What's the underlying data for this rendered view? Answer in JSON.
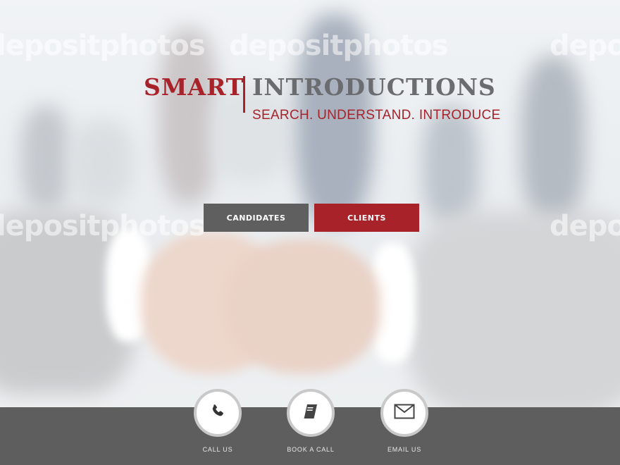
{
  "hero": {
    "watermark_text": "depositphotos"
  },
  "logo": {
    "word_primary": "SMART",
    "word_secondary": "INTRODUCTIONS",
    "tagline": "SEARCH. UNDERSTAND. INTRODUCE"
  },
  "buttons": {
    "candidates_label": "CANDIDATES",
    "clients_label": "CLIENTS"
  },
  "contact_actions": [
    {
      "label": "CALL US",
      "icon": "phone-icon"
    },
    {
      "label": "BOOK A CALL",
      "icon": "book-icon"
    },
    {
      "label": "EMAIL US",
      "icon": "envelope-icon"
    }
  ],
  "colors": {
    "brand_red": "#a8222a",
    "dark_gray": "#5f5f5f",
    "logo_gray": "#6a6c70"
  }
}
